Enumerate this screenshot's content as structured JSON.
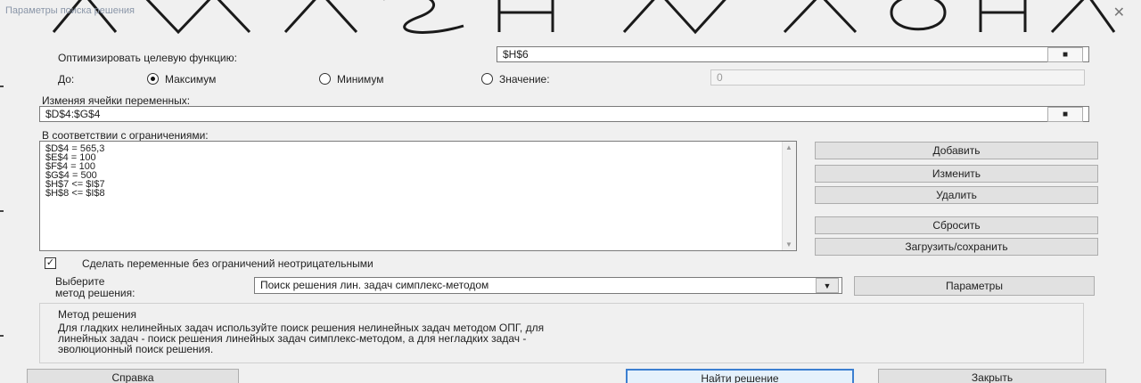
{
  "window": {
    "title": "Параметры поиска решения",
    "close_glyph": "✕"
  },
  "objective": {
    "label": "Оптимизировать целевую функцию:",
    "value": "$H$6",
    "ref_icon": "range-select-icon"
  },
  "goal": {
    "label": "До:",
    "options": [
      {
        "label": "Максимум",
        "checked": true
      },
      {
        "label": "Минимум",
        "checked": false
      },
      {
        "label": "Значение:",
        "checked": false
      }
    ],
    "value_text": "0"
  },
  "variables": {
    "label": "Изменяя ячейки переменных:",
    "value": "$D$4:$G$4"
  },
  "constraints": {
    "label": "В соответствии с ограничениями:",
    "items": [
      "$D$4 = 565,3",
      "$E$4 = 100",
      "$F$4 = 100",
      "$G$4 = 500",
      "$H$7 <= $I$7",
      "$H$8 <= $I$8"
    ],
    "buttons": {
      "add": "Добавить",
      "change": "Изменить",
      "delete": "Удалить",
      "reset": "Сбросить",
      "load_save": "Загрузить/сохранить"
    }
  },
  "nonneg": {
    "label": "Сделать переменные без ограничений неотрицательными",
    "checked": true
  },
  "method": {
    "label_line1": "Выберите",
    "label_line2": "метод решения:",
    "selected": "Поиск решения лин. задач симплекс-методом",
    "params_button": "Параметры"
  },
  "description": {
    "title": "Метод решения",
    "text_line1": "Для гладких нелинейных задач используйте поиск решения нелинейных задач методом ОПГ, для",
    "text_line2": "линейных задач - поиск решения линейных задач симплекс-методом, а для негладких задач -",
    "text_line3": "эволюционный поиск решения."
  },
  "footer": {
    "help": "Справка",
    "solve": "Найти решение",
    "close": "Закрыть"
  }
}
